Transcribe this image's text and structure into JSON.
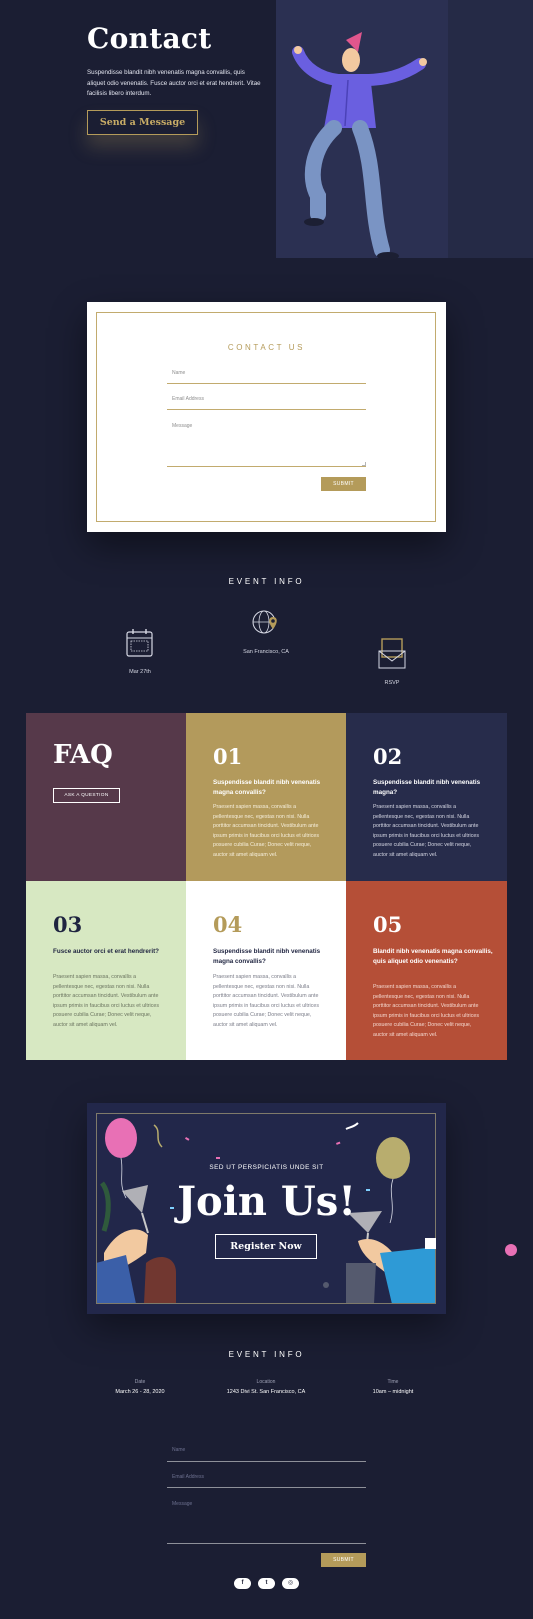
{
  "hero": {
    "title": "Contact",
    "text": "Suspendisse blandit nibh venenatis magna convallis, quis aliquet odio venenatis. Fusce auctor orci et erat hendrerit. Vitae facilisis libero interdum.",
    "button": "Send a Message"
  },
  "contact_form": {
    "title": "CONTACT US",
    "name_label": "Name",
    "email_label": "Email Address",
    "message_label": "Message",
    "submit": "SUBMIT"
  },
  "event_info": {
    "title": "EVENT INFO",
    "items": [
      {
        "label": "Mar 27th",
        "icon": "calendar-icon"
      },
      {
        "label": "San Francisco, CA",
        "icon": "globe-pin-icon"
      },
      {
        "label": "RSVP",
        "icon": "envelope-icon"
      }
    ]
  },
  "faq": {
    "title": "FAQ",
    "ask_button": "ASK A QUESTION",
    "items": [
      {
        "num": "01",
        "question": "Suspendisse blandit nibh venenatis magna convallis?",
        "answer": "Praesent sapien massa, convallis a pellentesque nec, egestas non nisi. Nulla porttitor accumsan tincidunt. Vestibulum ante ipsum primis in faucibus orci luctus et ultrices posuere cubilia Curae; Donec velit neque, auctor sit amet aliquam vel."
      },
      {
        "num": "02",
        "question": "Suspendisse blandit nibh venenatis magna?",
        "answer": "Praesent sapien massa, convallis a pellentesque nec, egestas non nisi. Nulla porttitor accumsan tincidunt. Vestibulum ante ipsum primis in faucibus orci luctus et ultrices posuere cubilia Curae; Donec velit neque, auctor sit amet aliquam vel."
      },
      {
        "num": "03",
        "question": "Fusce auctor orci et erat hendrerit?",
        "answer": "Praesent sapien massa, convallis a pellentesque nec, egestas non nisi. Nulla porttitor accumsan tincidunt. Vestibulum ante ipsum primis in faucibus orci luctus et ultrices posuere cubilia Curae; Donec velit neque, auctor sit amet aliquam vel."
      },
      {
        "num": "04",
        "question": "Suspendisse blandit nibh venenatis magna convallis?",
        "answer": "Praesent sapien massa, convallis a pellentesque nec, egestas non nisi. Nulla porttitor accumsan tincidunt. Vestibulum ante ipsum primis in faucibus orci luctus et ultrices posuere cubilia Curae; Donec velit neque, auctor sit amet aliquam vel."
      },
      {
        "num": "05",
        "question": "Blandit nibh venenatis magna convallis, quis aliquet odio venenatis?",
        "answer": "Praesent sapien massa, convallis a pellentesque nec, egestas non nisi. Nulla porttitor accumsan tincidunt. Vestibulum ante ipsum primis in faucibus orci luctus et ultrices posuere cubilia Curae; Donec velit neque, auctor sit amet aliquam vel."
      }
    ]
  },
  "join": {
    "kicker": "SED UT PERSPICIATIS UNDE SIT",
    "title": "Join Us!",
    "button": "Register Now"
  },
  "footer_info": {
    "title": "EVENT INFO",
    "date_label": "Date",
    "date_value": "March 26 - 28, 2020",
    "location_label": "Location",
    "location_value": "1243 Divi St. San Francisco, CA",
    "time_label": "Time",
    "time_value": "10am – midnight"
  },
  "footer_form": {
    "name_label": "Name",
    "email_label": "Email Address",
    "message_label": "Message",
    "submit": "SUBMIT"
  },
  "social": [
    {
      "icon": "facebook-icon",
      "glyph": "f"
    },
    {
      "icon": "twitter-icon",
      "glyph": "t"
    },
    {
      "icon": "instagram-icon",
      "glyph": "◎"
    }
  ],
  "colors": {
    "background": "#1b1e33",
    "gold": "#b49b5a",
    "faq_plum": "#56394a",
    "faq_gold": "#b39a5c",
    "faq_navy": "#272c4b",
    "faq_mint": "#d7e8c2",
    "faq_white": "#ffffff",
    "faq_rust": "#b54f37"
  }
}
